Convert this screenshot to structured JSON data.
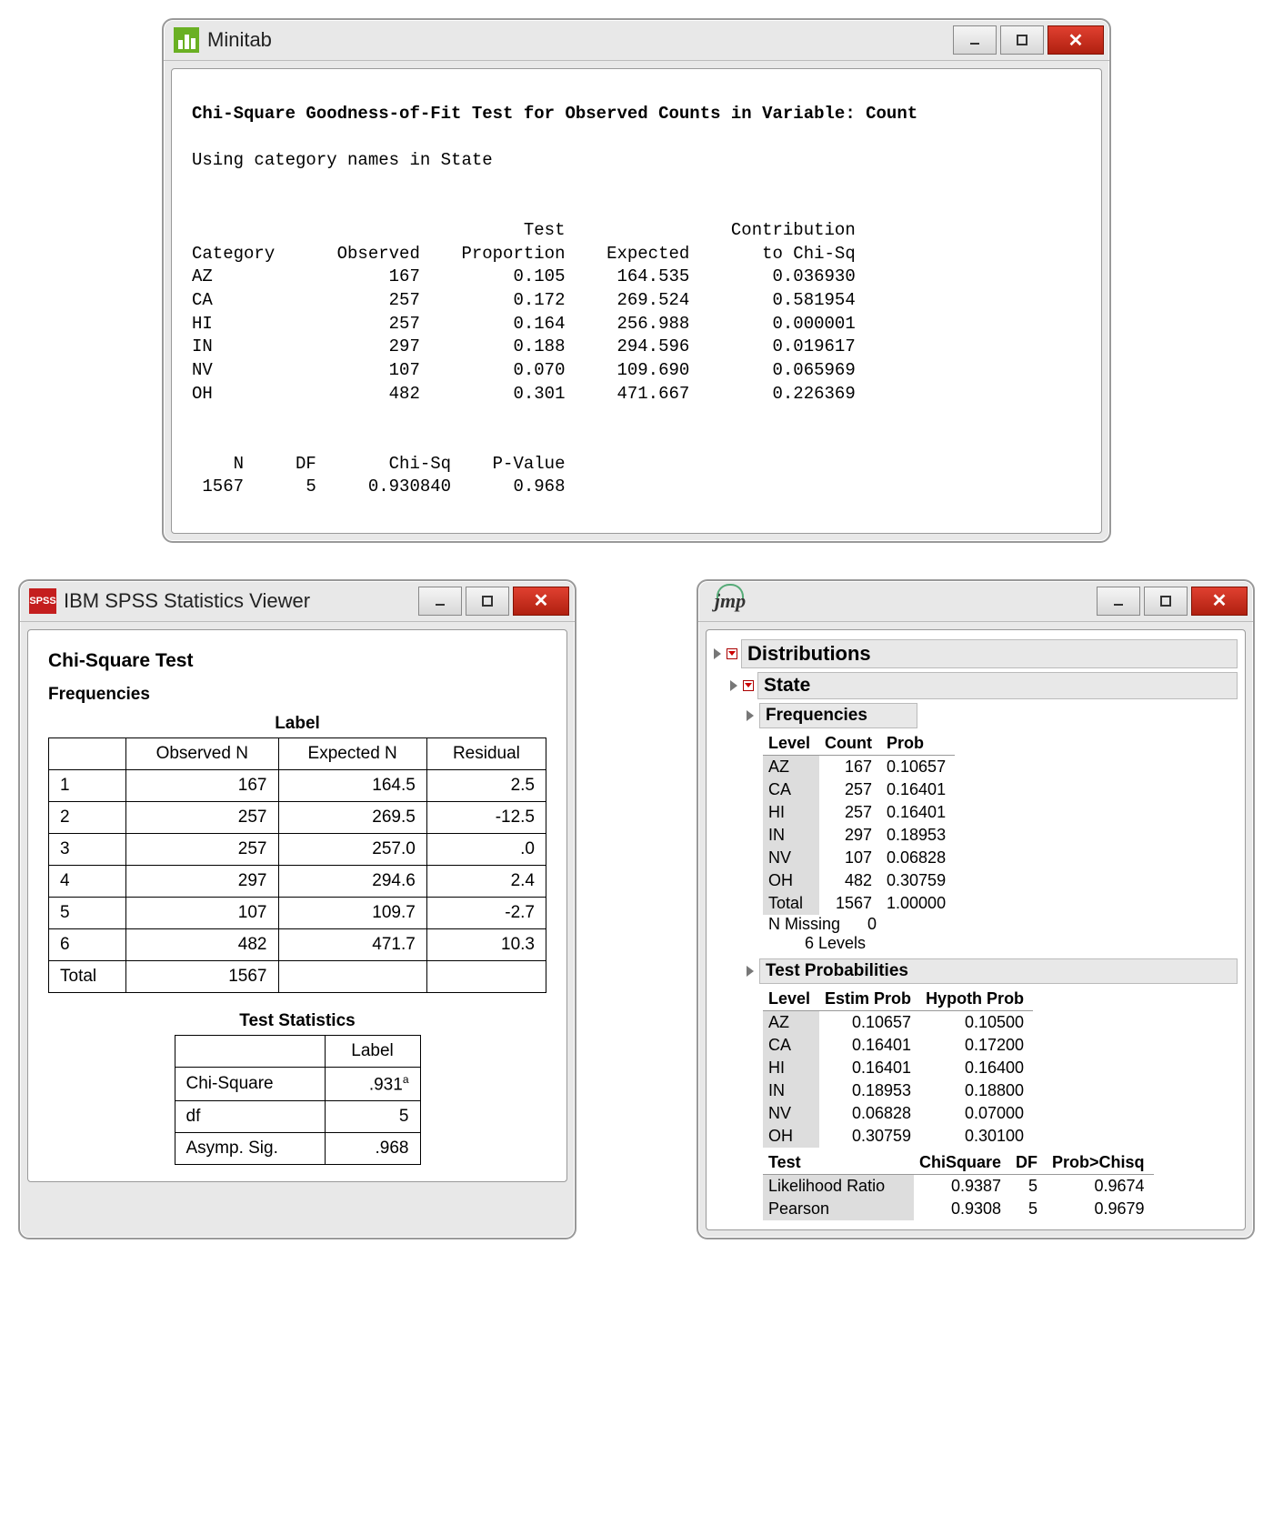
{
  "minitab": {
    "app_name": "Minitab",
    "heading": "Chi-Square Goodness-of-Fit Test for Observed Counts in Variable: Count",
    "subheading": "Using category names in State",
    "columns": {
      "category": "Category",
      "observed": "Observed",
      "test_prop_1": "Test",
      "test_prop_2": "Proportion",
      "expected": "Expected",
      "contrib_1": "Contribution",
      "contrib_2": "to Chi-Sq"
    },
    "rows": [
      {
        "cat": "AZ",
        "obs": "167",
        "prop": "0.105",
        "exp": "164.535",
        "contrib": "0.036930"
      },
      {
        "cat": "CA",
        "obs": "257",
        "prop": "0.172",
        "exp": "269.524",
        "contrib": "0.581954"
      },
      {
        "cat": "HI",
        "obs": "257",
        "prop": "0.164",
        "exp": "256.988",
        "contrib": "0.000001"
      },
      {
        "cat": "IN",
        "obs": "297",
        "prop": "0.188",
        "exp": "294.596",
        "contrib": "0.019617"
      },
      {
        "cat": "NV",
        "obs": "107",
        "prop": "0.070",
        "exp": "109.690",
        "contrib": "0.065969"
      },
      {
        "cat": "OH",
        "obs": "482",
        "prop": "0.301",
        "exp": "471.667",
        "contrib": "0.226369"
      }
    ],
    "summary_cols": {
      "n": "N",
      "df": "DF",
      "chisq": "Chi-Sq",
      "pvalue": "P-Value"
    },
    "summary": {
      "n": "1567",
      "df": "5",
      "chisq": "0.930840",
      "pvalue": "0.968"
    }
  },
  "spss": {
    "app_name": "IBM SPSS Statistics Viewer",
    "h1": "Chi-Square Test",
    "h2": "Frequencies",
    "table_caption": "Label",
    "cols": {
      "obs": "Observed N",
      "exp": "Expected N",
      "res": "Residual"
    },
    "rows": [
      {
        "lab": "1",
        "obs": "167",
        "exp": "164.5",
        "res": "2.5"
      },
      {
        "lab": "2",
        "obs": "257",
        "exp": "269.5",
        "res": "-12.5"
      },
      {
        "lab": "3",
        "obs": "257",
        "exp": "257.0",
        "res": ".0"
      },
      {
        "lab": "4",
        "obs": "297",
        "exp": "294.6",
        "res": "2.4"
      },
      {
        "lab": "5",
        "obs": "107",
        "exp": "109.7",
        "res": "-2.7"
      },
      {
        "lab": "6",
        "obs": "482",
        "exp": "471.7",
        "res": "10.3"
      }
    ],
    "total_label": "Total",
    "total_n": "1567",
    "stats_caption": "Test Statistics",
    "stats_col": "Label",
    "stats": {
      "chisq_label": "Chi-Square",
      "chisq_val": ".931",
      "chisq_foot": "a",
      "df_label": "df",
      "df_val": "5",
      "sig_label": "Asymp. Sig.",
      "sig_val": ".968"
    }
  },
  "jmp": {
    "app_name": "jmp",
    "sec_distributions": "Distributions",
    "sec_state": "State",
    "sec_freq": "Frequencies",
    "freq_cols": {
      "level": "Level",
      "count": "Count",
      "prob": "Prob"
    },
    "freq_rows": [
      {
        "level": "AZ",
        "count": "167",
        "prob": "0.10657"
      },
      {
        "level": "CA",
        "count": "257",
        "prob": "0.16401"
      },
      {
        "level": "HI",
        "count": "257",
        "prob": "0.16401"
      },
      {
        "level": "IN",
        "count": "297",
        "prob": "0.18953"
      },
      {
        "level": "NV",
        "count": "107",
        "prob": "0.06828"
      },
      {
        "level": "OH",
        "count": "482",
        "prob": "0.30759"
      }
    ],
    "freq_total_label": "Total",
    "freq_total_count": "1567",
    "freq_total_prob": "1.00000",
    "nmissing_label": "N Missing",
    "nmissing_val": "0",
    "levels_text": "6 Levels",
    "sec_testprob": "Test Probabilities",
    "tp_cols": {
      "level": "Level",
      "estim": "Estim Prob",
      "hypoth": "Hypoth Prob"
    },
    "tp_rows": [
      {
        "level": "AZ",
        "estim": "0.10657",
        "hypoth": "0.10500"
      },
      {
        "level": "CA",
        "estim": "0.16401",
        "hypoth": "0.17200"
      },
      {
        "level": "HI",
        "estim": "0.16401",
        "hypoth": "0.16400"
      },
      {
        "level": "IN",
        "estim": "0.18953",
        "hypoth": "0.18800"
      },
      {
        "level": "NV",
        "estim": "0.06828",
        "hypoth": "0.07000"
      },
      {
        "level": "OH",
        "estim": "0.30759",
        "hypoth": "0.30100"
      }
    ],
    "test_cols": {
      "test": "Test",
      "chisq": "ChiSquare",
      "df": "DF",
      "prob": "Prob>Chisq"
    },
    "test_rows": [
      {
        "test": "Likelihood Ratio",
        "chisq": "0.9387",
        "df": "5",
        "prob": "0.9674"
      },
      {
        "test": "Pearson",
        "chisq": "0.9308",
        "df": "5",
        "prob": "0.9679"
      }
    ]
  }
}
